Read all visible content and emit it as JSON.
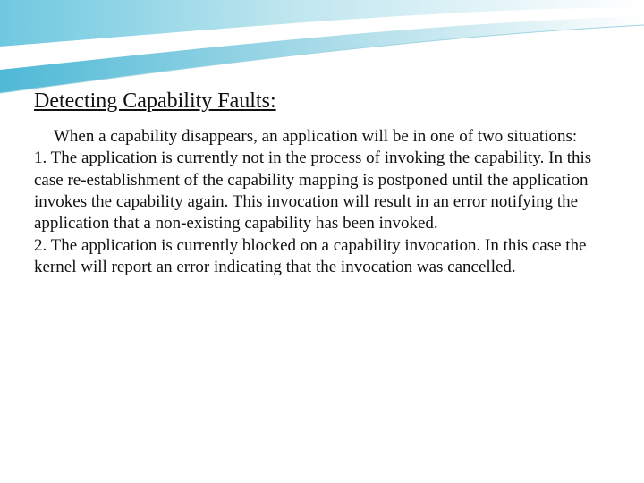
{
  "heading": "Detecting Capability Faults:",
  "intro": "When a capability disappears, an application will be in one of two situations:",
  "item1": "1. The application is currently not in the process of invoking the capability. In this case re-establishment of the capability mapping is postponed until the application invokes the capability again. This invocation will result in an error notifying the application that a non-existing capability has been invoked.",
  "item2": "2. The application is currently blocked on a capability invocation. In this case the kernel will report an error indicating that the invocation was cancelled."
}
